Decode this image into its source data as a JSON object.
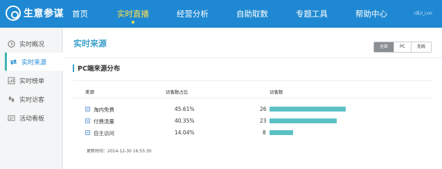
{
  "header": {
    "logo": "生意参谋",
    "nav": [
      "首页",
      "实时直播",
      "经营分析",
      "自助取数",
      "专题工具",
      "帮助中心"
    ],
    "active_index": 1,
    "user": "c乱ii_Lnn"
  },
  "sidebar": {
    "items": [
      {
        "label": "实时概况",
        "icon": "clock-icon"
      },
      {
        "label": "实时来源",
        "icon": "arrows-icon"
      },
      {
        "label": "实时榜单",
        "icon": "chart-icon"
      },
      {
        "label": "实时访客",
        "icon": "footprint-icon"
      },
      {
        "label": "活动看板",
        "icon": "board-icon"
      }
    ],
    "active_index": 1
  },
  "main": {
    "title": "实时来源",
    "filters": [
      "全部",
      "PC",
      "无线"
    ],
    "active_filter": 0,
    "section_title": "PC端来源分布",
    "columns": [
      "来源",
      "访客数占比",
      "访客数"
    ],
    "rows": [
      {
        "source": "淘内免费",
        "ratio": "45.61%",
        "visitors": "26",
        "value": 26
      },
      {
        "source": "付费流量",
        "ratio": "40.35%",
        "visitors": "23",
        "value": 23
      },
      {
        "source": "自主访问",
        "ratio": "14.04%",
        "visitors": "8",
        "value": 8
      }
    ],
    "update_time": "更新时间：2014-12-30 16:55:30"
  },
  "colors": {
    "header": "#1e88d2",
    "active_nav": "#ffe14a",
    "accent": "#3c9fc9",
    "bar": "#5cc1c4"
  }
}
